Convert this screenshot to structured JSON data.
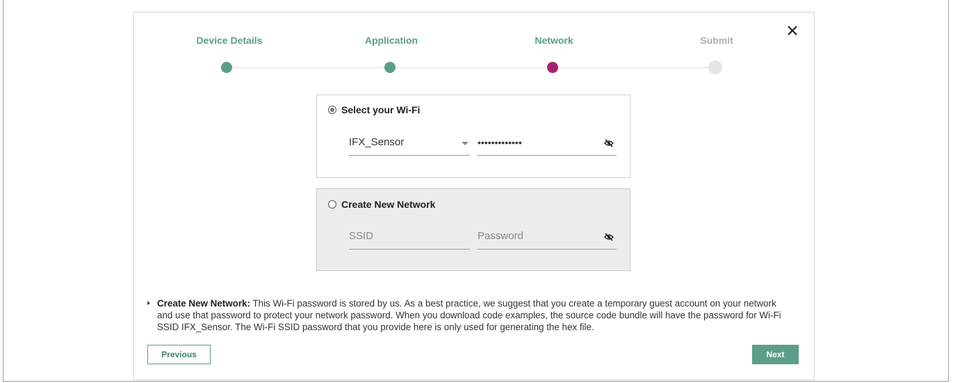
{
  "colors": {
    "accent_green": "#5a9e8a",
    "step_active": "#a3226a",
    "step_pending": "#e6e6e6",
    "label_done": "#5a9e8a",
    "label_pending": "#b0b0b0"
  },
  "stepper": {
    "steps": [
      {
        "label": "Device Details",
        "state": "completed"
      },
      {
        "label": "Application",
        "state": "completed"
      },
      {
        "label": "Network",
        "state": "active"
      },
      {
        "label": "Submit",
        "state": "pending"
      }
    ]
  },
  "close_icon": "close-icon",
  "wifi_option": {
    "title": "Select your Wi-Fi",
    "selected": true,
    "ssid_value": "IFX_Sensor",
    "password_value": "•••••••••••••",
    "eye_icon": "eye-slash-icon"
  },
  "new_network_option": {
    "title": "Create New Network",
    "selected": false,
    "ssid_placeholder": "SSID",
    "password_placeholder": "Password",
    "eye_icon": "eye-slash-icon"
  },
  "info": {
    "label": "Create New Network:",
    "text": "This Wi-Fi password is stored by us. As a best practice, we suggest that you create a temporary guest account on your network and use that password to protect your network password. When you download code examples, the source code bundle will have the password for Wi-Fi SSID IFX_Sensor. The Wi-Fi SSID password that you provide here is only used for generating the hex file."
  },
  "buttons": {
    "previous": "Previous",
    "next": "Next"
  }
}
